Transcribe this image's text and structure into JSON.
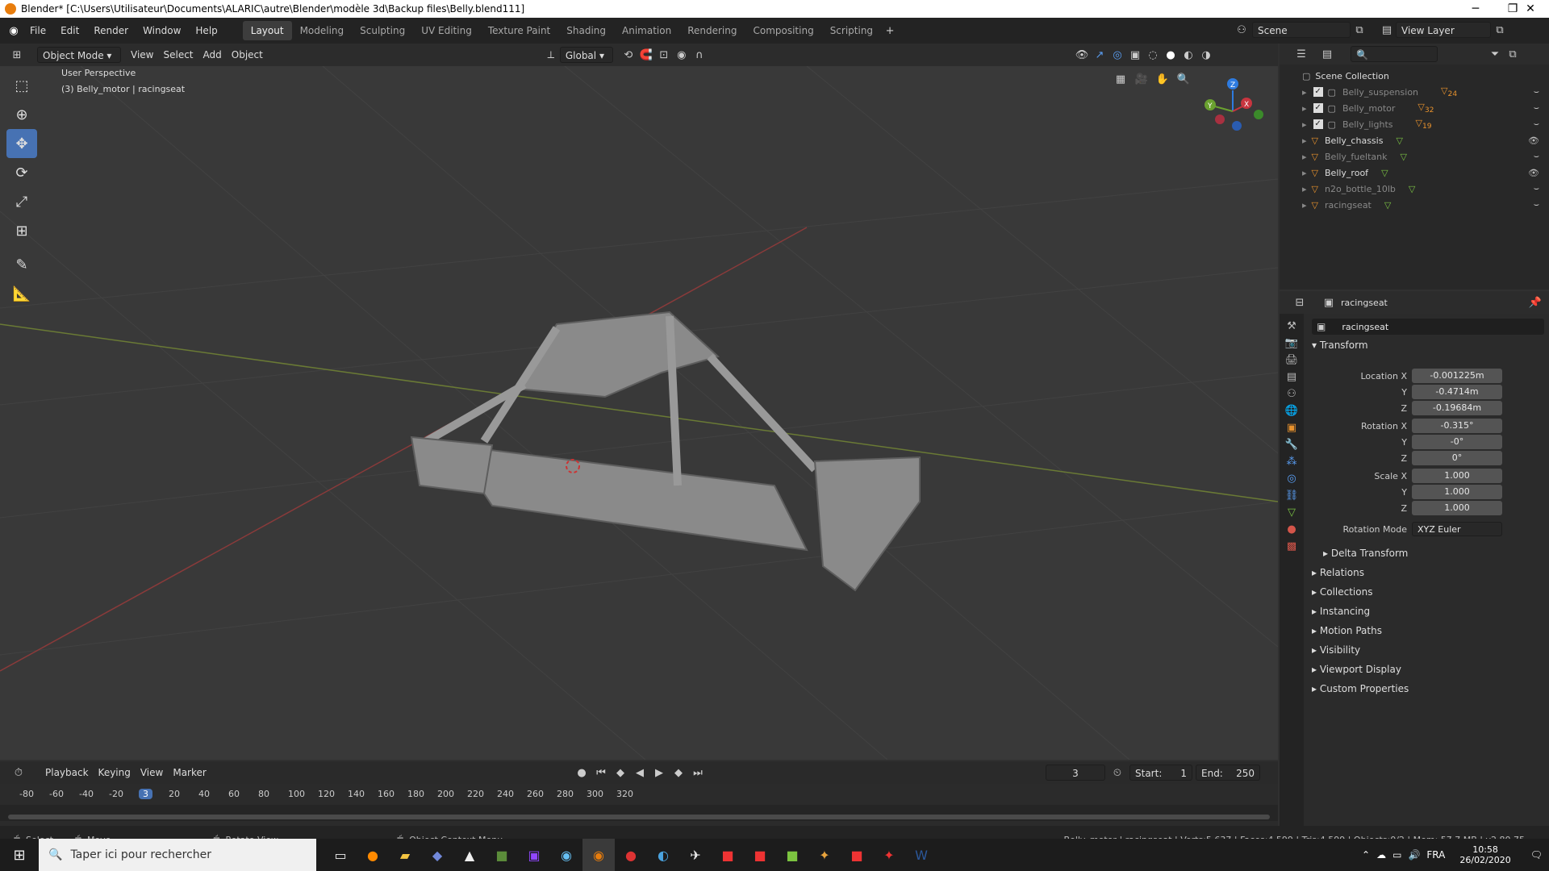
{
  "titlebar": {
    "title": "Blender* [C:\\Users\\Utilisateur\\Documents\\ALARIC\\autre\\Blender\\modèle 3d\\Backup files\\Belly.blend111]"
  },
  "menu": [
    "File",
    "Edit",
    "Render",
    "Window",
    "Help"
  ],
  "workspaces": [
    "Layout",
    "Modeling",
    "Sculpting",
    "UV Editing",
    "Texture Paint",
    "Shading",
    "Animation",
    "Rendering",
    "Compositing",
    "Scripting"
  ],
  "scene": {
    "label": "Scene",
    "view_layer": "View Layer"
  },
  "viewport_header": {
    "mode": "Object Mode",
    "view": "View",
    "select": "Select",
    "add": "Add",
    "object": "Object",
    "orientation": "Global"
  },
  "viewport": {
    "perspective": "User Perspective",
    "context": "(3) Belly_motor | racingseat"
  },
  "outliner": {
    "root": "Scene Collection",
    "items": [
      {
        "name": "Belly_suspension",
        "count": "24"
      },
      {
        "name": "Belly_motor",
        "count": "32"
      },
      {
        "name": "Belly_lights",
        "count": "19"
      },
      {
        "name": "Belly_chassis"
      },
      {
        "name": "Belly_fueltank"
      },
      {
        "name": "Belly_roof"
      },
      {
        "name": "n2o_bottle_10lb"
      },
      {
        "name": "racingseat"
      }
    ]
  },
  "properties": {
    "object_name": "racingseat",
    "object_field": "racingseat",
    "transform_label": "Transform",
    "location_label": "Location X",
    "location": {
      "x": "-0.001225m",
      "y": "-0.4714m",
      "z": "-0.19684m"
    },
    "rotation_label": "Rotation X",
    "rotation": {
      "x": "-0.315°",
      "y": "-0°",
      "z": "0°"
    },
    "scale_label": "Scale X",
    "scale": {
      "x": "1.000",
      "y": "1.000",
      "z": "1.000"
    },
    "y_label": "Y",
    "z_label": "Z",
    "rotation_mode_label": "Rotation Mode",
    "rotation_mode": "XYZ Euler",
    "panels": [
      "Delta Transform",
      "Relations",
      "Collections",
      "Instancing",
      "Motion Paths",
      "Visibility",
      "Viewport Display",
      "Custom Properties"
    ]
  },
  "timeline": {
    "playback": "Playback",
    "keying": "Keying",
    "view": "View",
    "marker": "Marker",
    "current": "3",
    "start_label": "Start:",
    "start": "1",
    "end_label": "End:",
    "end": "250",
    "ticks": [
      "-80",
      "-60",
      "-40",
      "-20",
      "3",
      "20",
      "40",
      "60",
      "80",
      "100",
      "120",
      "140",
      "160",
      "180",
      "200",
      "220",
      "240",
      "260",
      "280",
      "300",
      "320"
    ]
  },
  "statusbar": {
    "select": "Select",
    "move": "Move",
    "rotate": "Rotate View",
    "context": "Object Context Menu",
    "stats": "Belly_motor | racingseat | Verts:5,637 | Faces:4,599 | Tris:4,599 | Objects:0/2 | Mem: 57.7 MB | v2.80.75"
  },
  "taskbar": {
    "search": "Taper ici pour rechercher",
    "lang": "FRA",
    "time": "10:58",
    "date": "26/02/2020"
  }
}
